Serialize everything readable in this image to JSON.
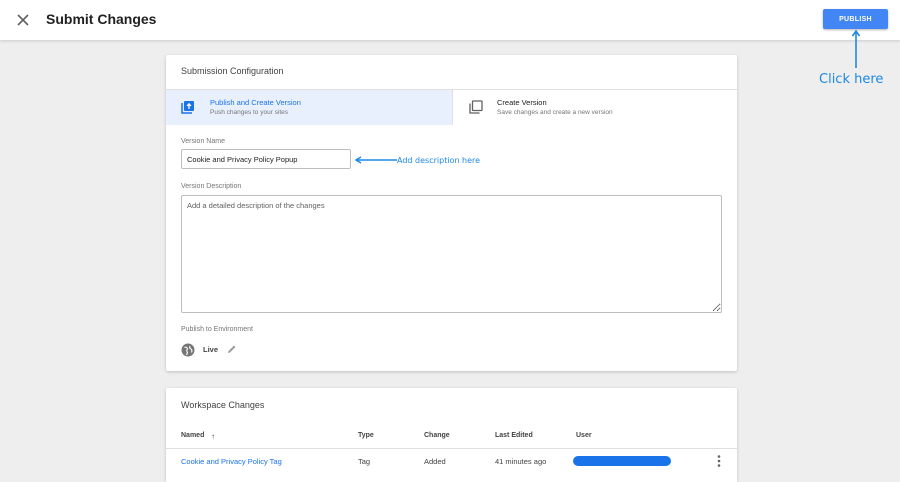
{
  "header": {
    "title": "Submit Changes",
    "publish_label": "PUBLISH"
  },
  "annotations": {
    "click_here": "Click here",
    "add_description": "Add description here",
    "arrow_color": "#1e88e5"
  },
  "config": {
    "title": "Submission Configuration",
    "options": [
      {
        "title": "Publish and Create Version",
        "subtitle": "Push changes to your sites",
        "icon": "publish-upload-icon",
        "selected": true
      },
      {
        "title": "Create Version",
        "subtitle": "Save changes and create a new version",
        "icon": "copy-version-icon",
        "selected": false
      }
    ],
    "version_name_label": "Version Name",
    "version_name_value": "Cookie and Privacy Policy Popup",
    "version_description_label": "Version Description",
    "version_description_placeholder": "Add a detailed description of the changes",
    "environment_label": "Publish to Environment",
    "environment_value": "Live"
  },
  "workspace": {
    "title": "Workspace Changes",
    "columns": [
      "Named",
      "Type",
      "Change",
      "Last Edited",
      "User"
    ],
    "sort_indicator": "↑",
    "rows": [
      {
        "name": "Cookie and Privacy Policy Tag",
        "type": "Tag",
        "change": "Added",
        "last_edited": "41 minutes ago"
      }
    ]
  },
  "colors": {
    "accent": "#4285f4",
    "link": "#1a73e8",
    "selected_bg": "#e8f0fe"
  }
}
